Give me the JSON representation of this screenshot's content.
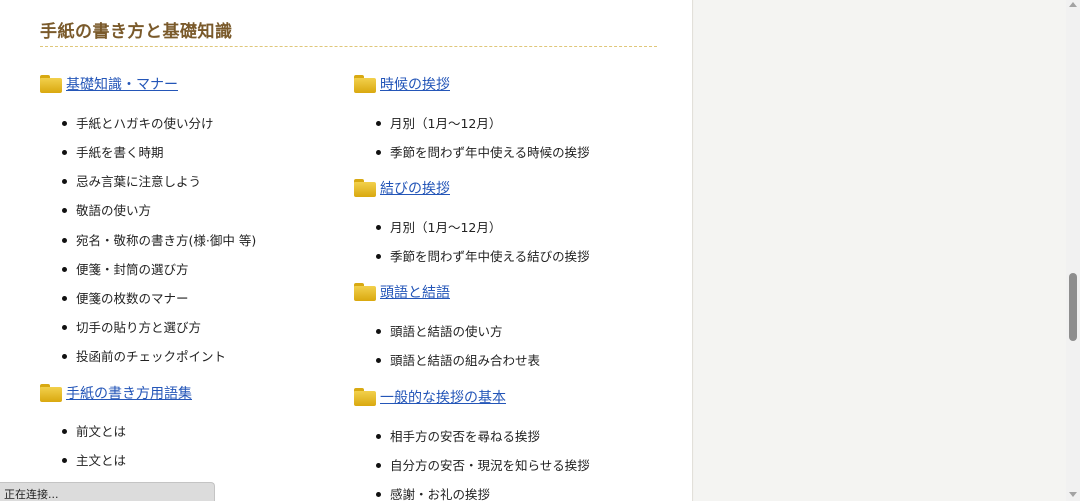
{
  "section_title": "手紙の書き方と基礎知識",
  "left": {
    "cat1": {
      "label": "基礎知識・マナー",
      "items": [
        "手紙とハガキの使い分け",
        "手紙を書く時期",
        "忌み言葉に注意しよう",
        "敬語の使い方",
        "宛名・敬称の書き方(様·御中 等)",
        "便箋・封筒の選び方",
        "便箋の枚数のマナー",
        "切手の貼り方と選び方",
        "投函前のチェックポイント"
      ]
    },
    "cat2": {
      "label": "手紙の書き方用語集",
      "items": [
        "前文とは",
        "主文とは"
      ]
    }
  },
  "right": {
    "cat1": {
      "label": "時候の挨拶",
      "items": [
        "月別（1月～12月）",
        "季節を問わず年中使える時候の挨拶"
      ]
    },
    "cat2": {
      "label": "結びの挨拶",
      "items": [
        "月別（1月～12月）",
        "季節を問わず年中使える結びの挨拶"
      ]
    },
    "cat3": {
      "label": "頭語と結語",
      "items": [
        "頭語と結語の使い方",
        "頭語と結語の組み合わせ表"
      ]
    },
    "cat4": {
      "label": "一般的な挨拶の基本",
      "items": [
        "相手方の安否を尋ねる挨拶",
        "自分方の安否・現況を知らせる挨拶",
        "感謝・お礼の挨拶"
      ]
    }
  },
  "status_text": "正在连接...",
  "colors": {
    "title": "#7a5a2b",
    "link": "#2456b8",
    "folder": "#e6bb22"
  }
}
